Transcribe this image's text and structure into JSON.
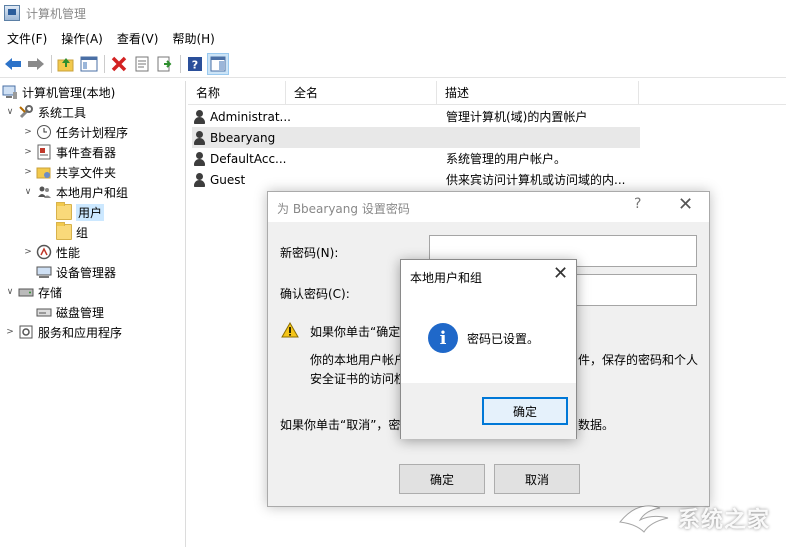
{
  "window": {
    "title": "计算机管理"
  },
  "menu": [
    "文件(F)",
    "操作(A)",
    "查看(V)",
    "帮助(H)"
  ],
  "toolbar_icons": [
    "back-icon",
    "forward-icon",
    "up-folder-icon",
    "show-tree-icon",
    "delete-icon",
    "properties-icon",
    "export-icon",
    "help-icon",
    "show-action-pane-icon"
  ],
  "tree": {
    "root": "计算机管理(本地)",
    "system_tools": "系统工具",
    "task_scheduler": "任务计划程序",
    "event_viewer": "事件查看器",
    "shared_folders": "共享文件夹",
    "local_users_groups": "本地用户和组",
    "users": "用户",
    "groups": "组",
    "performance": "性能",
    "device_manager": "设备管理器",
    "storage": "存储",
    "disk_management": "磁盘管理",
    "services_apps": "服务和应用程序"
  },
  "list": {
    "columns": {
      "name": "名称",
      "fullname": "全名",
      "description": "描述"
    },
    "rows": [
      {
        "name": "Administrat...",
        "description": "管理计算机(域)的内置帐户"
      },
      {
        "name": "Bbearyang",
        "description": ""
      },
      {
        "name": "DefaultAcc...",
        "description": "系统管理的用户帐户。"
      },
      {
        "name": "Guest",
        "description": "供来宾访问计算机或访问域的内..."
      }
    ]
  },
  "set_password_dialog": {
    "title": "为 Bbearyang 设置密码",
    "help_glyph": "?",
    "close_glyph": "✕",
    "new_password_label": "新密码(N):",
    "confirm_password_label": "确认密码(C):",
    "warning_line1": "如果你单击“确定",
    "warning_line2_left": "你的本地用户帐户",
    "warning_line2_right": "件，保存的密码和个人",
    "warning_line3": "安全证书的访问权",
    "cancel_note_left": "如果你单击“取消”，密",
    "cancel_note_right": "数据。",
    "ok_label": "确定",
    "cancel_label": "取消"
  },
  "message_box": {
    "title": "本地用户和组",
    "close_glyph": "✕",
    "info_glyph": "i",
    "message": "密码已设置。",
    "ok_label": "确定"
  },
  "watermark": {
    "text": "系统之家"
  }
}
